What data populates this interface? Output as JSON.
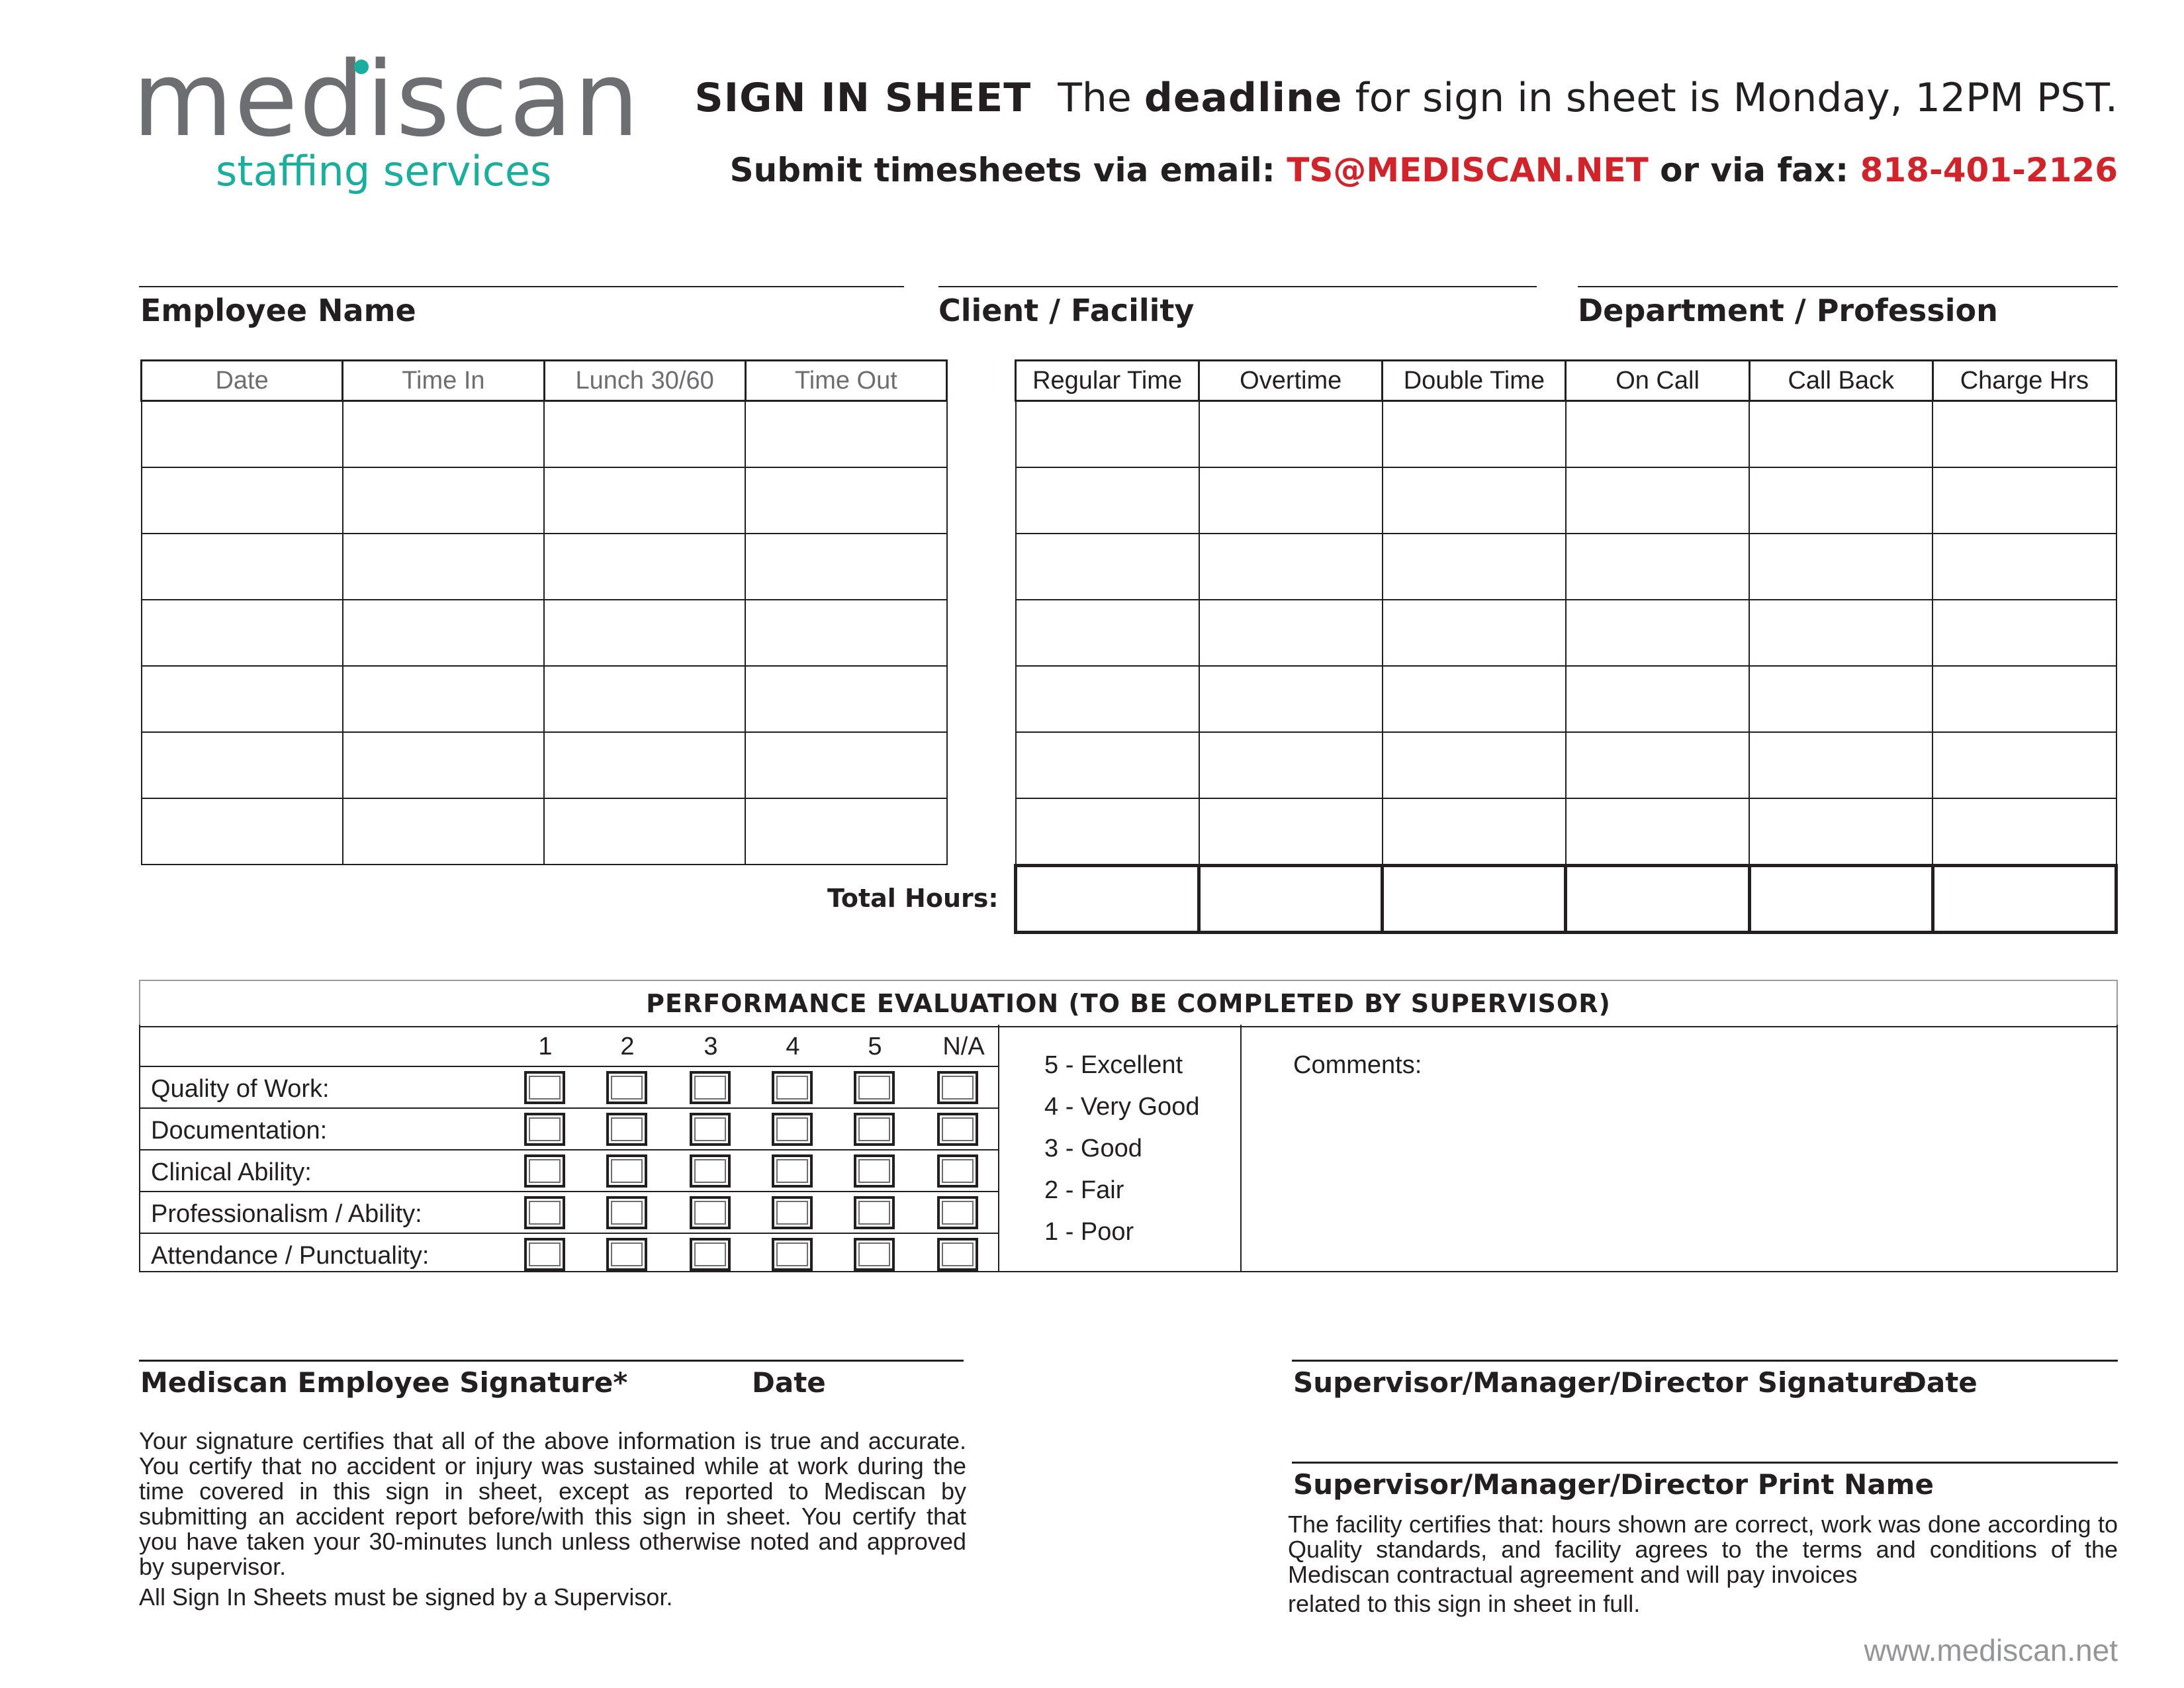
{
  "logo": {
    "main": "mediscan",
    "sub": "staffing services"
  },
  "header": {
    "title": "SIGN IN SHEET",
    "deadline_prefix": "The",
    "deadline_bold": "deadline",
    "deadline_suffix": "for sign in sheet is Monday, 12PM PST.",
    "submit_prefix": "Submit timesheets via email:",
    "email": "TS@MEDISCAN.NET",
    "fax_prefix": "or via fax:",
    "fax": "818-401-2126",
    "accent_color": "#d1232a",
    "brand_color": "#1aae9f"
  },
  "info_fields": {
    "employee_name": "Employee Name",
    "client_facility": "Client / Facility",
    "department_profession": "Department / Profession"
  },
  "time_table": {
    "headers": [
      "Date",
      "Time In",
      "Lunch 30/60",
      "Time Out"
    ]
  },
  "hours_table": {
    "headers": [
      "Regular Time",
      "Overtime",
      "Double Time",
      "On Call",
      "Call Back",
      "Charge Hrs"
    ],
    "total_label": "Total Hours:"
  },
  "evaluation": {
    "title": "PERFORMANCE EVALUATION (TO BE COMPLETED BY SUPERVISOR)",
    "ratings": [
      "1",
      "2",
      "3",
      "4",
      "5",
      "N/A"
    ],
    "criteria": [
      "Quality of Work:",
      "Documentation:",
      "Clinical Ability:",
      "Professionalism / Ability:",
      "Attendance / Punctuality:"
    ],
    "legend": [
      "5 - Excellent",
      "4 - Very Good",
      "3 - Good",
      "2 - Fair",
      "1 - Poor"
    ],
    "comments_label": "Comments:"
  },
  "signatures": {
    "employee_signature": "Mediscan Employee Signature*",
    "employee_date": "Date",
    "employee_certification": "Your signature certifies that all of the above information is true and accurate. You certify that no accident or injury was sustained while at work during the time covered in this sign in sheet, except as reported to Mediscan by submitting an accident report before/with this sign in sheet. You certify that you have taken your 30-minutes lunch unless otherwise noted  and approved by supervisor.",
    "employee_note": "All Sign In Sheets must be signed by a Supervisor.",
    "supervisor_signature": "Supervisor/Manager/Director Signature",
    "supervisor_date": "Date",
    "supervisor_print": "Supervisor/Manager/Director Print Name",
    "facility_certification": "The facility certifies that: hours shown are correct, work was done according to Quality standards, and facility agrees to the terms and conditions of the Mediscan contractual agreement and will pay invoices",
    "facility_certification_end": "related to this sign in sheet in full."
  },
  "footer": {
    "website": "www.mediscan.net"
  }
}
